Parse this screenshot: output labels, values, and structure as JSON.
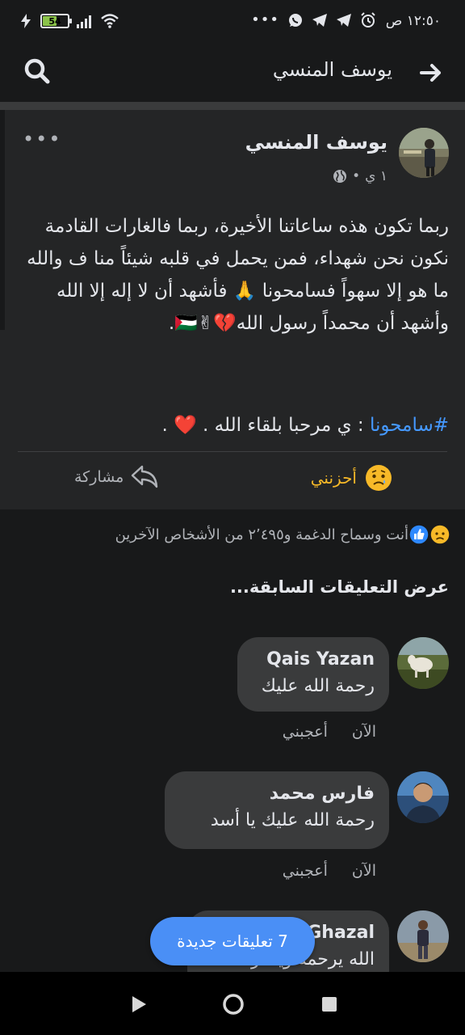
{
  "status_bar": {
    "time": "١٢:٥٠ ص",
    "battery": "54",
    "icons": [
      "alarm-icon",
      "telegram-icon",
      "telegram-icon",
      "whatsapp-icon",
      "more-dots-icon"
    ],
    "left_icons": [
      "wifi-icon",
      "signal-icon",
      "battery-icon",
      "charging-icon"
    ]
  },
  "header": {
    "title": "يوسف المنسي"
  },
  "post": {
    "author": "يوسف المنسي",
    "time": "١ ي",
    "separator": "•",
    "more": "•••",
    "text": "ربما تكون هذه ساعاتنا الأخيرة، ربما فالغارات القادمة نكون نحن شهداء، فمن يحمل في قلبه شيئاً منا ف والله ما هو إلا سهواً فسامحونا 🙏 فأشهد أن لا إله إلا الله وأشهد أن محمداً رسول الله💔✌🇵🇸.",
    "hashtag": "#سامحونا",
    "hashtag_rest": ": ي مرحبا بلقاء الله . ❤️ .",
    "react_label": "أحزنني",
    "share_label": "مشاركة"
  },
  "reactions": {
    "summary": "أنت وسماح الدغمة و٢٬٤٩٥ من الأشخاص الآخرين"
  },
  "prev_comments_label": "عرض التعليقات السابقة...",
  "comments": [
    {
      "name": "Qais Yazan",
      "text": "رحمة الله عليك",
      "time": "الآن",
      "like": "أعجبني"
    },
    {
      "name": "فارس محمد",
      "text": "رحمة الله عليك يا أسد",
      "time": "الآن",
      "like": "أعجبني"
    },
    {
      "name": "Ghazal",
      "text": "الله يرحمه ويغفر له"
    }
  ],
  "new_comments_button": "7 تعليقات جديدة",
  "colors": {
    "background": "#18191a",
    "card": "#242526",
    "bubble": "#3a3b3c",
    "accent_blue": "#4599ff",
    "sad_yellow": "#f7b928",
    "button_blue": "#4a8ff6"
  }
}
